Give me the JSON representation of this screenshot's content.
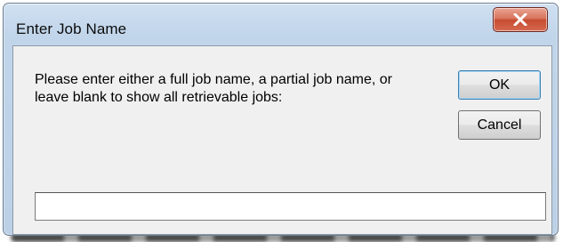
{
  "window": {
    "title": "Enter Job Name",
    "close_icon": "close-icon"
  },
  "dialog": {
    "prompt": "Please enter either a full job name, a partial job name, or\nleave blank to show all retrievable jobs:",
    "ok_label": "OK",
    "cancel_label": "Cancel",
    "job_name_value": ""
  },
  "colors": {
    "title_bar": "#c1d5ea",
    "close_button": "#c74c32",
    "client_background": "#f0f0f0"
  }
}
